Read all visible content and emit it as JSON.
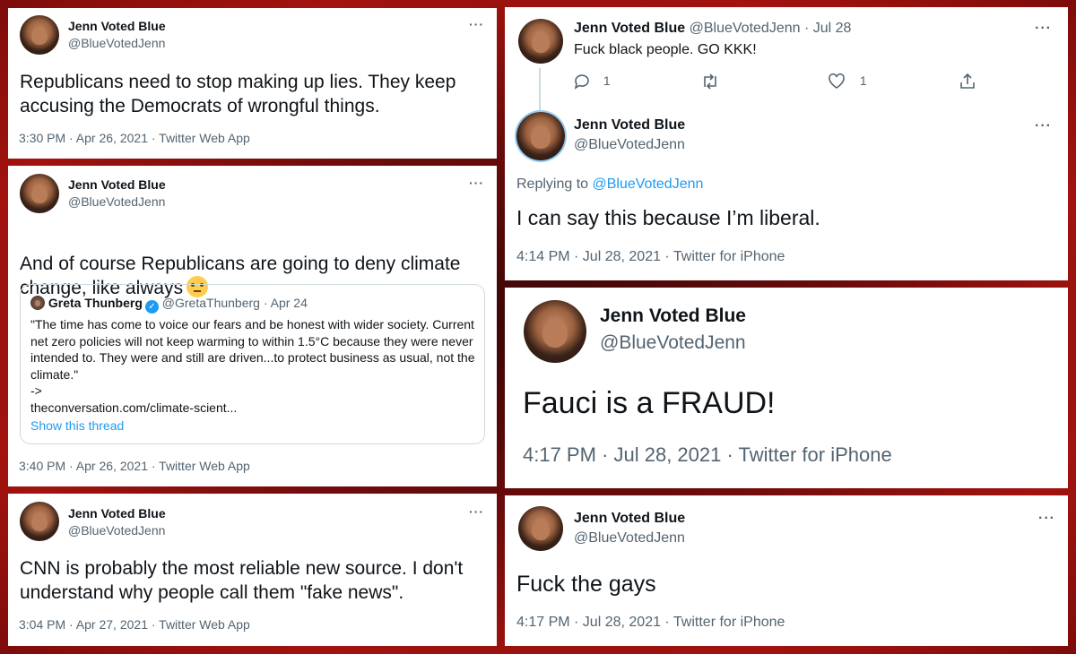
{
  "tweets": [
    {
      "name": "Jenn Voted Blue",
      "handle": "@BlueVotedJenn",
      "text": "Republicans need to stop making up lies. They keep accusing the Democrats of wrongful things.",
      "meta": "3:30 PM · Apr 26, 2021 · Twitter Web App"
    },
    {
      "name": "Jenn Voted Blue",
      "handle": "@BlueVotedJenn",
      "text": "And of course Republicans are going to deny climate change, like always",
      "emoji": "face-with-rolling-eyes-emoji",
      "meta": "3:40 PM · Apr 26, 2021 · Twitter Web App",
      "quote": {
        "name": "Greta Thunberg",
        "handle": "@GretaThunberg",
        "date": "· Apr 24",
        "text": "\"The time has come to voice our fears and be honest with wider society. Current net zero policies will not keep warming to within 1.5°C because they were never intended to. They were and still are driven...to protect business as usual, not the climate.\"\n->\ntheconversation.com/climate-scient...",
        "link": "Show this thread"
      }
    },
    {
      "name": "Jenn Voted Blue",
      "handle": "@BlueVotedJenn",
      "text": "CNN is probably the most reliable new source. I don't understand why people call them \"fake news\".",
      "meta": "3:04 PM · Apr 27, 2021 · Twitter Web App"
    },
    {
      "name": "Jenn Voted Blue",
      "handle": "@BlueVotedJenn",
      "date": "· Jul 28",
      "text": "Fuck black people. GO KKK!",
      "actions": {
        "replies": "1",
        "likes": "1"
      },
      "reply": {
        "name": "Jenn Voted Blue",
        "handle": "@BlueVotedJenn",
        "replying_prefix": "Replying to",
        "replying_to": "@BlueVotedJenn",
        "text": "I can say this because I’m liberal.",
        "meta": "4:14 PM · Jul 28, 2021 · Twitter for iPhone"
      }
    },
    {
      "name": "Jenn Voted Blue",
      "handle": "@BlueVotedJenn",
      "text": "Fauci is a FRAUD!",
      "meta": "4:17 PM · Jul 28, 2021 · Twitter for iPhone"
    },
    {
      "name": "Jenn Voted Blue",
      "handle": "@BlueVotedJenn",
      "text": "Fuck the gays",
      "meta": "4:17 PM · Jul 28, 2021 · Twitter for iPhone"
    }
  ],
  "more_glyph": "···",
  "colors": {
    "link": "#1d9bf0",
    "secondary_text": "#536471",
    "background_red": "#a3130f"
  }
}
